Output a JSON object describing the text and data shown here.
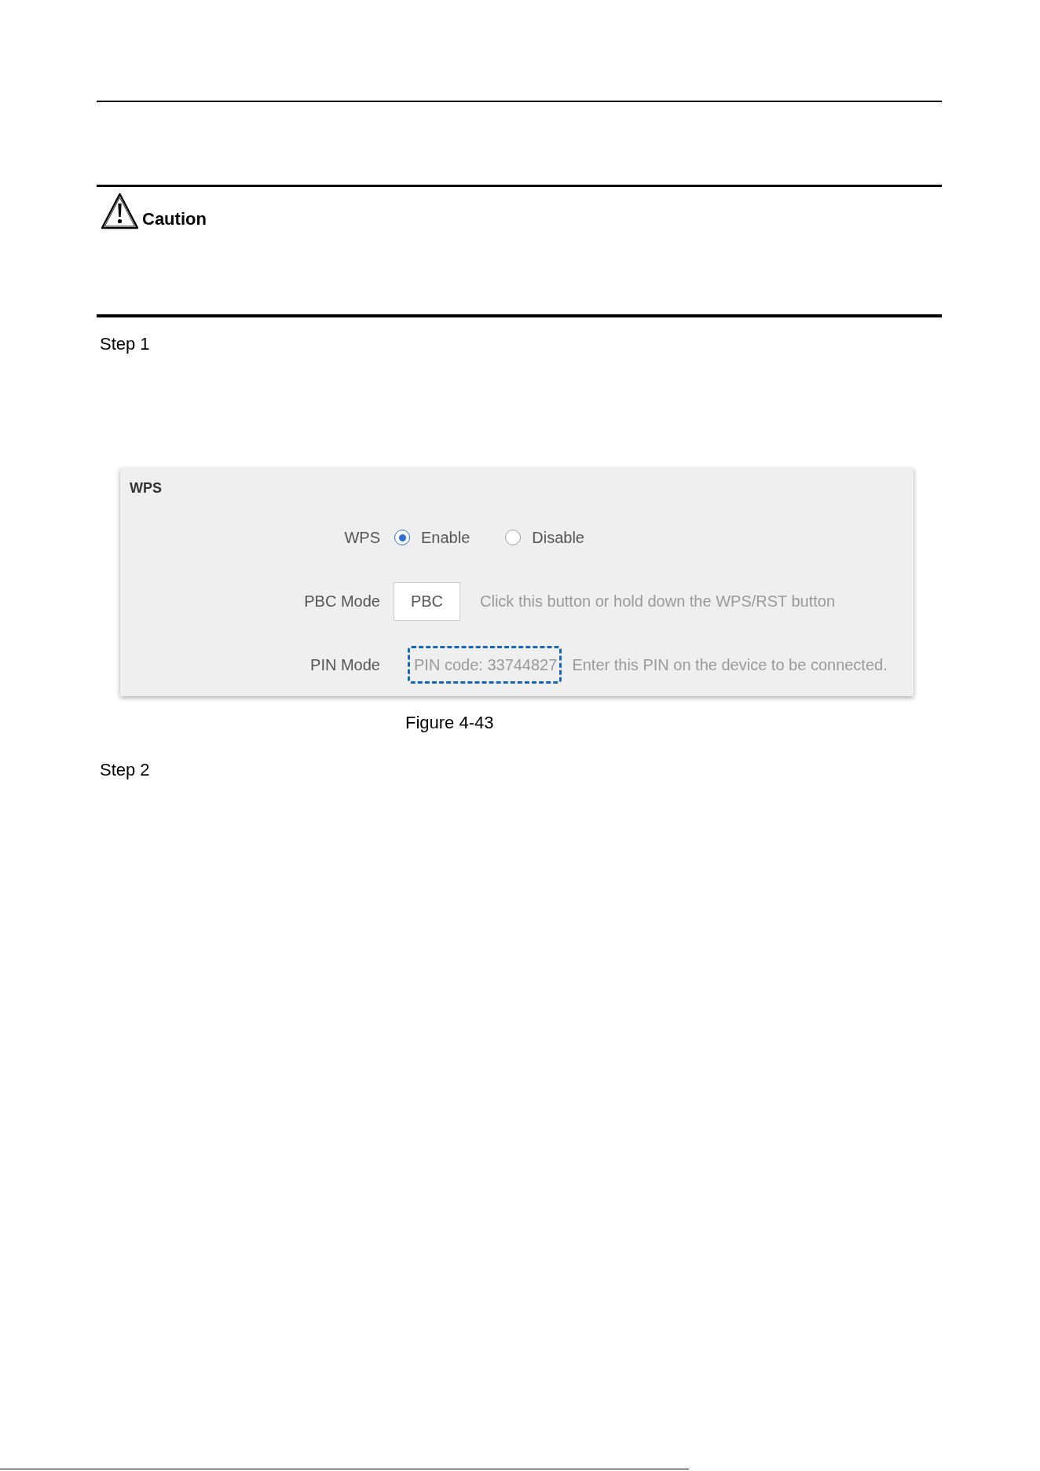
{
  "caution": {
    "title": "Caution"
  },
  "step_1": {
    "label": "Step 1"
  },
  "figure": {
    "panel": {
      "title": "WPS",
      "rows": [
        {
          "kind": "radio",
          "label": "WPS",
          "options": [
            {
              "label": "Enable",
              "selected": true
            },
            {
              "label": "Disable",
              "selected": false
            }
          ]
        },
        {
          "kind": "button",
          "label": "PBC Mode",
          "button": "PBC",
          "hint": "Click this button or hold down the WPS/RST button"
        },
        {
          "kind": "pin",
          "label": "PIN Mode",
          "pin": "PIN code: 33744827",
          "highlighted": true,
          "hint": "Enter this PIN on the device to be connected."
        }
      ]
    },
    "caption": "Figure 4-43"
  },
  "step_2": {
    "label": "Step 2"
  }
}
